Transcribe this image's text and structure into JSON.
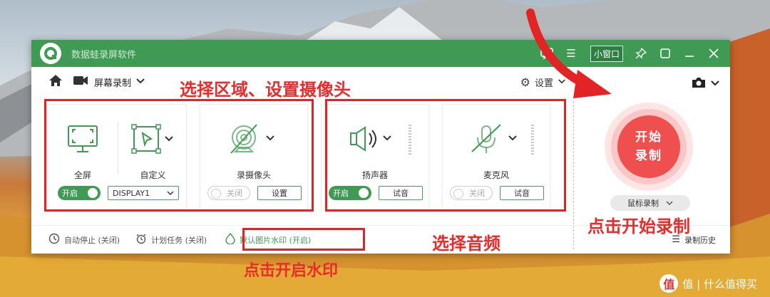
{
  "app": {
    "title": "数据蛙录屏软件",
    "mini_window_label": "小窗口"
  },
  "toolbar": {
    "mode_label": "屏幕录制",
    "settings_label": "设置"
  },
  "cards": {
    "fullscreen": {
      "label": "全屏",
      "toggle_label": "开启"
    },
    "custom": {
      "label": "自定义",
      "display_value": "DISPLAY1"
    },
    "webcam": {
      "label": "录摄像头",
      "toggle_label": "关闭",
      "button_label": "设置"
    },
    "speaker": {
      "label": "扬声器",
      "toggle_label": "开启",
      "button_label": "试音"
    },
    "microphone": {
      "label": "麦克风",
      "toggle_label": "关闭",
      "button_label": "试音"
    }
  },
  "record": {
    "button_label": "开始录制",
    "mouse_record_label": "鼠标录制"
  },
  "statusbar": {
    "auto_stop": "自动停止 (关闭)",
    "schedule": "计划任务 (关闭)",
    "watermark": "默认图片水印 (开启)",
    "history": "录制历史"
  },
  "annotations": {
    "select_area": "选择区域、设置摄像头",
    "select_audio": "选择音频",
    "click_record": "点击开始录制",
    "click_watermark": "点击开启水印"
  },
  "footer": {
    "site": "值 | 什么值得买"
  },
  "colors": {
    "brand_green": "#3f9a54",
    "annotation_red": "#e32424",
    "record_red": "#ef4f4f"
  }
}
